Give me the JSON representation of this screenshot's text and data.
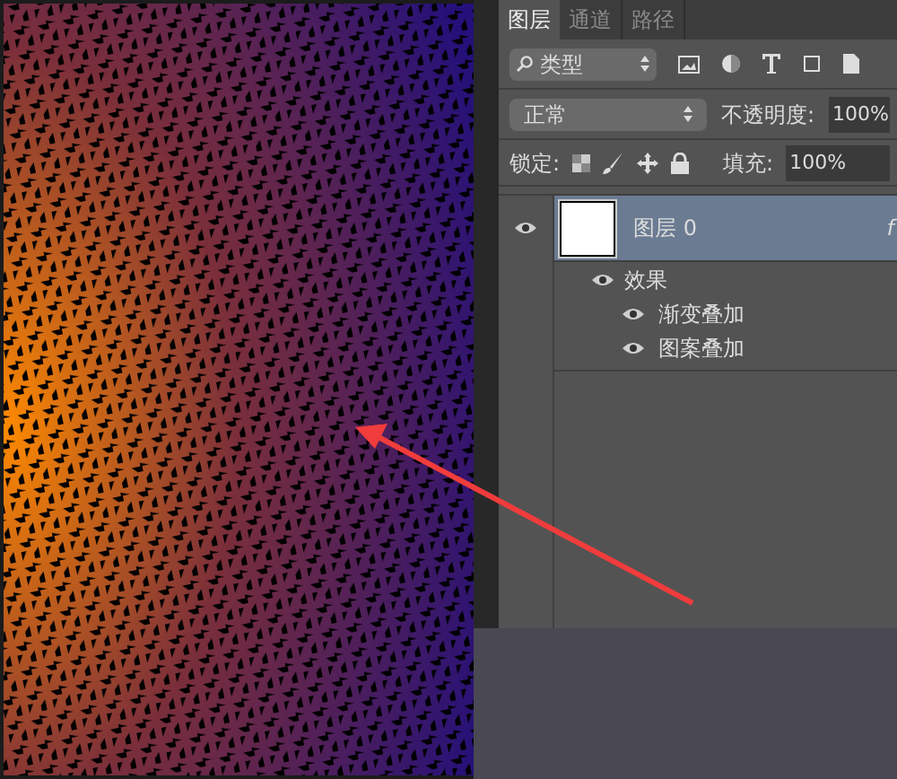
{
  "tabs": [
    {
      "label": "图层",
      "selected": true
    },
    {
      "label": "通道",
      "selected": false
    },
    {
      "label": "路径",
      "selected": false
    }
  ],
  "filter": {
    "label": "类型"
  },
  "blend_mode": {
    "value": "正常"
  },
  "opacity": {
    "label": "不透明度:",
    "value": "100%"
  },
  "lock": {
    "label": "锁定:"
  },
  "fill": {
    "label": "填充:",
    "value": "100%"
  },
  "layers": [
    {
      "name": "图层 0",
      "selected": true,
      "visible": true,
      "effects_badge": "f",
      "effects": {
        "label": "效果",
        "visible": true,
        "children": [
          {
            "name": "渐变叠加",
            "visible": true
          },
          {
            "name": "图案叠加",
            "visible": true
          }
        ]
      }
    }
  ]
}
